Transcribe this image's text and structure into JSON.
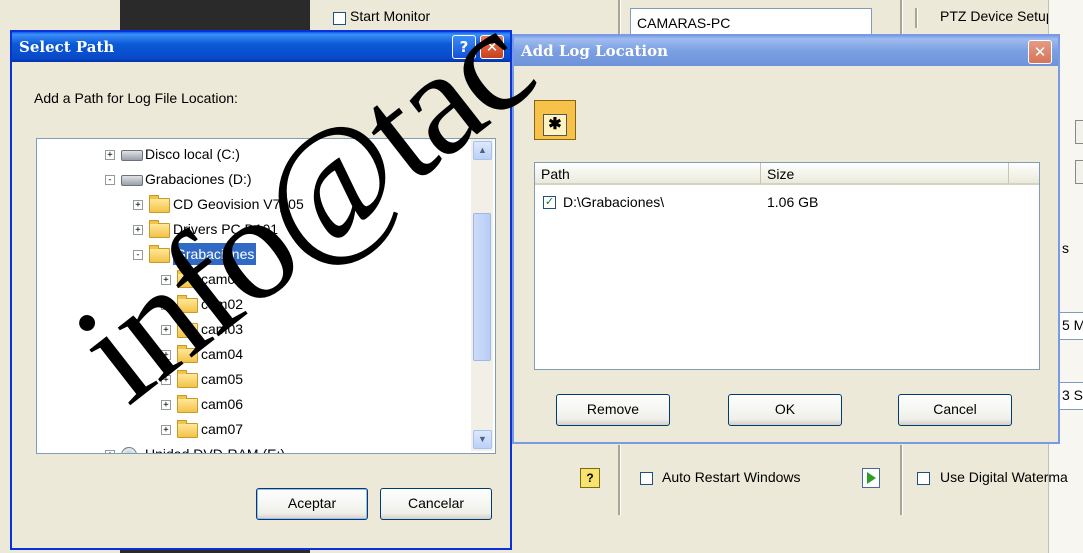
{
  "watermark": "info@tac",
  "background": {
    "start_monitor": "Start Monitor",
    "computer_name": "CAMARAS-PC",
    "ptz_setup": "PTZ Device Setup:",
    "auto_restart": "Auto Restart Windows",
    "digital_watermark": "Use Digital Waterma",
    "right_value_1": "5 M",
    "right_value_2": "3 S",
    "right_s": "s"
  },
  "select_path": {
    "title": "Select Path",
    "prompt": "Add a Path for Log File Location:",
    "tree": [
      {
        "label": "Disco local (C:)",
        "kind": "drive",
        "level": 0,
        "expander": "+"
      },
      {
        "label": "Grabaciones (D:)",
        "kind": "drive",
        "level": 0,
        "expander": "−"
      },
      {
        "label": "CD Geovision V7_05",
        "kind": "folder",
        "level": 1,
        "expander": "+"
      },
      {
        "label": "Drivers PC D101",
        "kind": "folder",
        "level": 1,
        "expander": "+"
      },
      {
        "label": "Grabaciones",
        "kind": "folder",
        "level": 1,
        "expander": "−",
        "selected": true
      },
      {
        "label": "cam01",
        "kind": "folder",
        "level": 2,
        "expander": "+"
      },
      {
        "label": "cam02",
        "kind": "folder",
        "level": 2,
        "expander": "+"
      },
      {
        "label": "cam03",
        "kind": "folder",
        "level": 2,
        "expander": "+"
      },
      {
        "label": "cam04",
        "kind": "folder",
        "level": 2,
        "expander": "+"
      },
      {
        "label": "cam05",
        "kind": "folder",
        "level": 2,
        "expander": "+"
      },
      {
        "label": "cam06",
        "kind": "folder",
        "level": 2,
        "expander": "+"
      },
      {
        "label": "cam07",
        "kind": "folder",
        "level": 2,
        "expander": "+"
      },
      {
        "label": "Unidad DVD-RAM (E:)",
        "kind": "dvd",
        "level": 0,
        "expander": "+"
      }
    ],
    "ok_label": "Aceptar",
    "cancel_label": "Cancelar"
  },
  "add_log": {
    "title": "Add Log Location",
    "columns": [
      "Path",
      "Size"
    ],
    "rows": [
      {
        "checked": true,
        "path": "D:\\Grabaciones\\",
        "size": "1.06 GB"
      }
    ],
    "remove_label": "Remove",
    "ok_label": "OK",
    "cancel_label": "Cancel"
  },
  "colors": {
    "title_bar": "#0b5ad6",
    "selection": "#316ac5",
    "dialog_face": "#ece9d8"
  }
}
